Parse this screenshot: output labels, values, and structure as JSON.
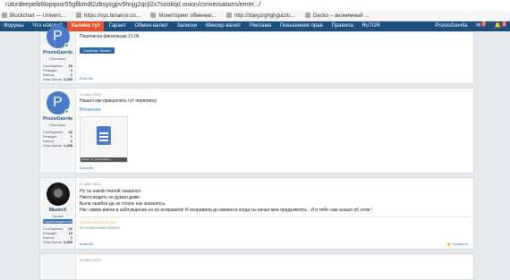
{
  "browser": {
    "url": "rutordeepeib6lopqoor55gflbmdt2zbsyxgpv5hnjg2qcjl2x7sookqd.onion/conversations/emer.../",
    "bookmarks": [
      {
        "label": "Blockchair — Univers..."
      },
      {
        "label": "https://sys.binance.co..."
      },
      {
        "label": "Мониторинг обменни..."
      },
      {
        "label": "http://3qeyzrghghguizlo..."
      },
      {
        "label": "Gecko – анонимный ..."
      }
    ]
  },
  "nav": {
    "items": [
      "Форумы",
      "Что нового?",
      "Халява тут",
      "Гарант",
      "Обмен валют",
      "Записки",
      "Миксер валют",
      "Реклама",
      "Повышение прав",
      "Правила",
      "RuTOR"
    ],
    "active_index": 2,
    "user": "ProstoGavrila",
    "badges": [
      "2",
      "1"
    ]
  },
  "posts": [
    {
      "avatar_letter": "P",
      "username": "ProstoGavrila",
      "usertitle": "Пассажир",
      "stats": [
        {
          "label": "Сообщения",
          "value": "16"
        },
        {
          "label": "Реакции",
          "value": "1"
        },
        {
          "label": "Баллы",
          "value": "1"
        },
        {
          "label": "Хеш-баллы",
          "value": "1,258"
        }
      ],
      "message": "Переписка финальная 21.06",
      "spoiler": "Спойлер: Финал",
      "like_link": "Жалоба"
    },
    {
      "avatar_letter": "P",
      "username": "ProstoGavrila",
      "usertitle": "Пассажир",
      "stats": [
        {
          "label": "Сообщения",
          "value": "16"
        },
        {
          "label": "Реакции",
          "value": "1"
        },
        {
          "label": "Баллы",
          "value": "1"
        },
        {
          "label": "Хеш-баллы",
          "value": "1,258"
        }
      ],
      "date": "21 Июн 2023",
      "message": "Нашел как прикрепить тут переписку",
      "attach_label": "Вложения",
      "attach_caption": "screen_of_conversation...",
      "like_link": "Жалоба"
    },
    {
      "username": "MasterX",
      "usertitle": "Гарант",
      "roles": [
        "Подтвержденный"
      ],
      "stats": [
        {
          "label": "Сообщения",
          "value": "10"
        },
        {
          "label": "Реакции",
          "value": "10"
        },
        {
          "label": "Баллы",
          "value": "1"
        },
        {
          "label": "Хеш-баллы",
          "value": "1,308"
        }
      ],
      "date": "21 Июн 2023",
      "lines": [
        "Ну ты какой-тчилой оказался",
        "Никто водить не думал даже.",
        "Была ошибка да не спорю как оказалось.",
        "Нас самих ввели в заблуждение,но ее исправили! И исправили до момента когда ты начал мне предъявлять . И я тебе сам сказал об этом !"
      ],
      "sig1": "ГАРАНТИЯ 100% 24/7",
      "sig2": "МГНОВЕННЫЙ ОБМЕН",
      "like_link": "Жалоба",
      "complain": "Нравится"
    },
    {
      "date": "21 Июн 2023"
    }
  ]
}
